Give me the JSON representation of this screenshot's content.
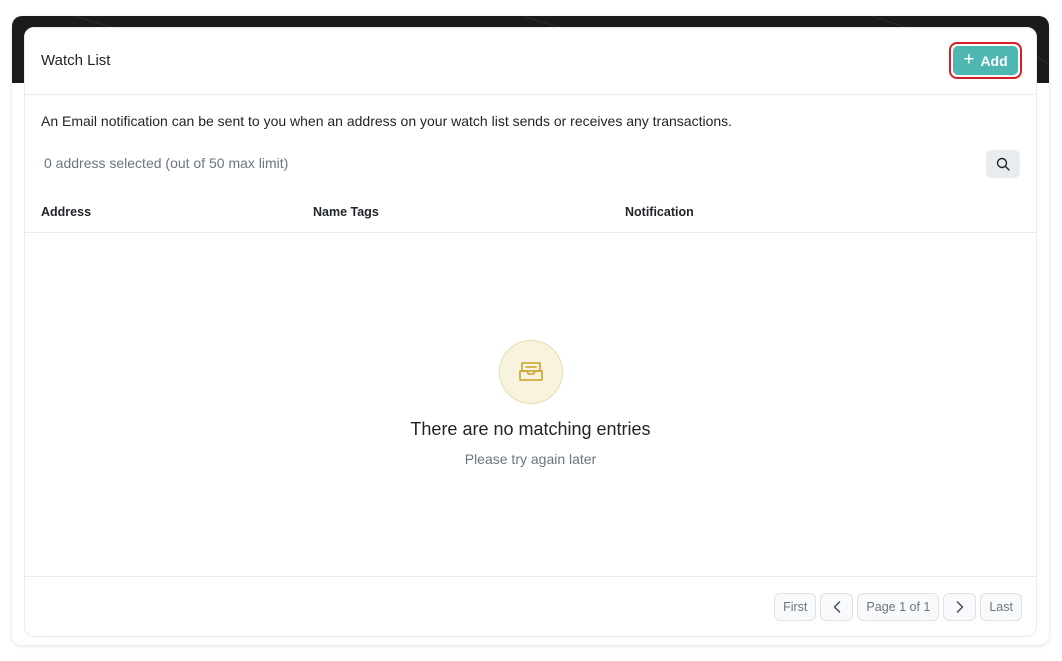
{
  "card": {
    "title": "Watch List",
    "add_label": "Add",
    "description": "An Email notification can be sent to you when an address on your watch list sends or receives any transactions.",
    "selected_text": "0 address selected (out of 50 max limit)"
  },
  "table": {
    "columns": [
      "Address",
      "Name Tags",
      "Notification"
    ]
  },
  "empty_state": {
    "title": "There are no matching entries",
    "subtitle": "Please try again later",
    "icon": "inbox-icon"
  },
  "pagination": {
    "first": "First",
    "page_info": "Page 1 of 1",
    "last": "Last"
  },
  "colors": {
    "accent": "#4fb7b1",
    "highlight_border": "#d91f26",
    "empty_icon_color": "#c9a227"
  }
}
